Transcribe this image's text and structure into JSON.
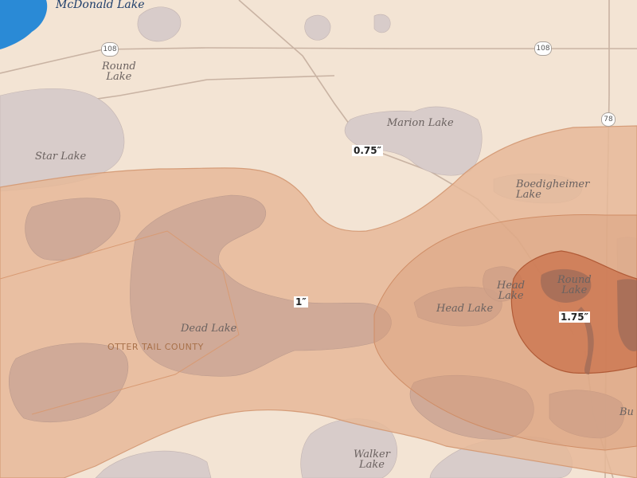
{
  "map": {
    "colors": {
      "land": "#f3e4d4",
      "water": "#d8ccca",
      "open_water": "#2a8ad6",
      "band_light": "#e6b899",
      "band_mid": "#d79c78",
      "band_dark": "#c9724b",
      "road": "#c9b3a3"
    },
    "lakes": [
      {
        "id": "mcdonald",
        "line1": "McDonald Lake",
        "line2": ""
      },
      {
        "id": "round_nw",
        "line1": "Round",
        "line2": "Lake"
      },
      {
        "id": "star",
        "line1": "Star Lake",
        "line2": ""
      },
      {
        "id": "marion",
        "line1": "Marion Lake",
        "line2": ""
      },
      {
        "id": "boedigheimer",
        "line1": "Boedigheimer",
        "line2": "Lake"
      },
      {
        "id": "head_small",
        "line1": "Head",
        "line2": "Lake"
      },
      {
        "id": "round_e",
        "line1": "Round",
        "line2": "Lake"
      },
      {
        "id": "head",
        "line1": "Head Lake",
        "line2": ""
      },
      {
        "id": "dead",
        "line1": "Dead Lake",
        "line2": ""
      },
      {
        "id": "walker",
        "line1": "Walker",
        "line2": "Lake"
      },
      {
        "id": "bu",
        "line1": "Bu",
        "line2": ""
      }
    ],
    "county_label": "OTTER TAIL COUNTY",
    "road_shields": [
      {
        "id": "hwy108_w",
        "number": "108"
      },
      {
        "id": "hwy108_e",
        "number": "108"
      },
      {
        "id": "hwy78",
        "number": "78"
      }
    ],
    "contour_labels": [
      {
        "id": "c075",
        "text": "0.75″"
      },
      {
        "id": "c1",
        "text": "1″"
      },
      {
        "id": "c175",
        "text": "1.75″"
      }
    ]
  }
}
